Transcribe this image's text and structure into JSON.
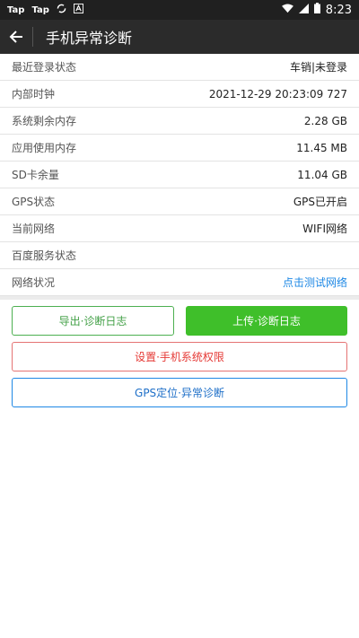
{
  "statusbar": {
    "left_labels": [
      "Tap",
      "Tap"
    ],
    "time": "8:23",
    "icons": [
      "sync-icon",
      "text-icon",
      "wifi-icon",
      "signal-icon",
      "battery-icon"
    ]
  },
  "appbar": {
    "back_icon": "arrow-left-icon",
    "title": "手机异常诊断"
  },
  "info_rows": [
    {
      "label": "最近登录状态",
      "value": "车销|未登录"
    },
    {
      "label": "内部时钟",
      "value": "2021-12-29 20:23:09 727"
    },
    {
      "label": "系统剩余内存",
      "value": "2.28 GB"
    },
    {
      "label": "应用使用内存",
      "value": "11.45 MB"
    },
    {
      "label": "SD卡余量",
      "value": "11.04 GB"
    },
    {
      "label": "GPS状态",
      "value": "GPS已开启"
    },
    {
      "label": "当前网络",
      "value": "WIFI网络"
    },
    {
      "label": "百度服务状态",
      "value": ""
    },
    {
      "label": "网络状况",
      "value": "点击测试网络"
    }
  ],
  "buttons": {
    "export": "导出·诊断日志",
    "upload": "上传·诊断日志",
    "settings": "设置·手机系统权限",
    "gps": "GPS定位·异常诊断"
  },
  "colors": {
    "appbar": "#2b2b2b",
    "green": "#3fbf2a",
    "red": "#e53935",
    "blue": "#1e88e5"
  }
}
